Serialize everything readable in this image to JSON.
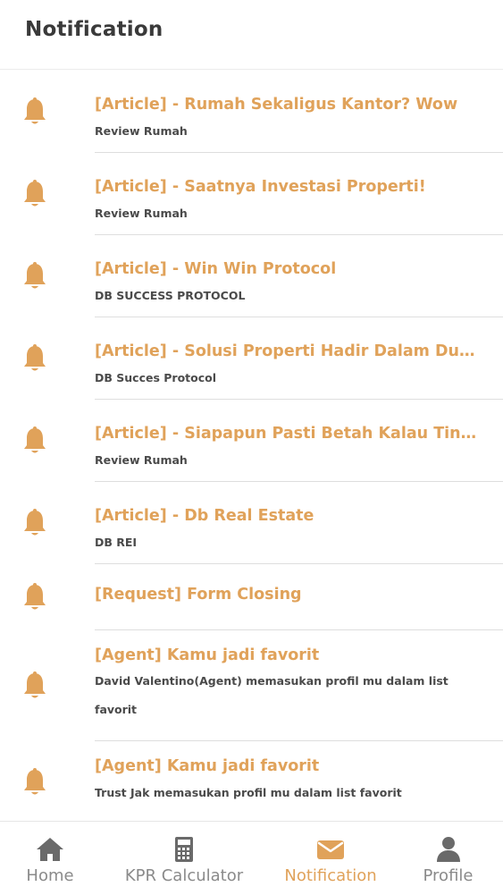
{
  "header": {
    "title": "Notification"
  },
  "notifications": [
    {
      "title": "[Article] - Rumah Sekaligus Kantor? Wow",
      "subtitle": "Review Rumah"
    },
    {
      "title": "[Article] - Saatnya Investasi Properti!",
      "subtitle": "Review Rumah"
    },
    {
      "title": "[Article] - Win Win Protocol",
      "subtitle": "DB SUCCESS PROTOCOL"
    },
    {
      "title": "[Article] - Solusi Properti Hadir Dalam Dunia...",
      "subtitle": "DB Succes Protocol"
    },
    {
      "title": "[Article] - Siapapun Pasti Betah Kalau Tingg...",
      "subtitle": "Review Rumah"
    },
    {
      "title": "[Article] - Db Real Estate",
      "subtitle": "DB REI"
    },
    {
      "title": "[Request] Form Closing",
      "subtitle": ""
    },
    {
      "title": "[Agent] Kamu jadi favorit",
      "subtitle": "David Valentino(Agent) memasukan profil mu dalam list favorit"
    },
    {
      "title": "[Agent] Kamu jadi favorit",
      "subtitle": "Trust Jak memasukan profil mu dalam list favorit"
    }
  ],
  "tabs": [
    {
      "label": "Home",
      "icon": "home-icon"
    },
    {
      "label": "KPR Calculator",
      "icon": "calculator-icon"
    },
    {
      "label": "Notification",
      "icon": "mail-icon",
      "active": true
    },
    {
      "label": "Profile",
      "icon": "person-icon"
    }
  ],
  "colors": {
    "accent": "#e0a25a",
    "text": "#333333",
    "muted": "#8a8a8a"
  }
}
